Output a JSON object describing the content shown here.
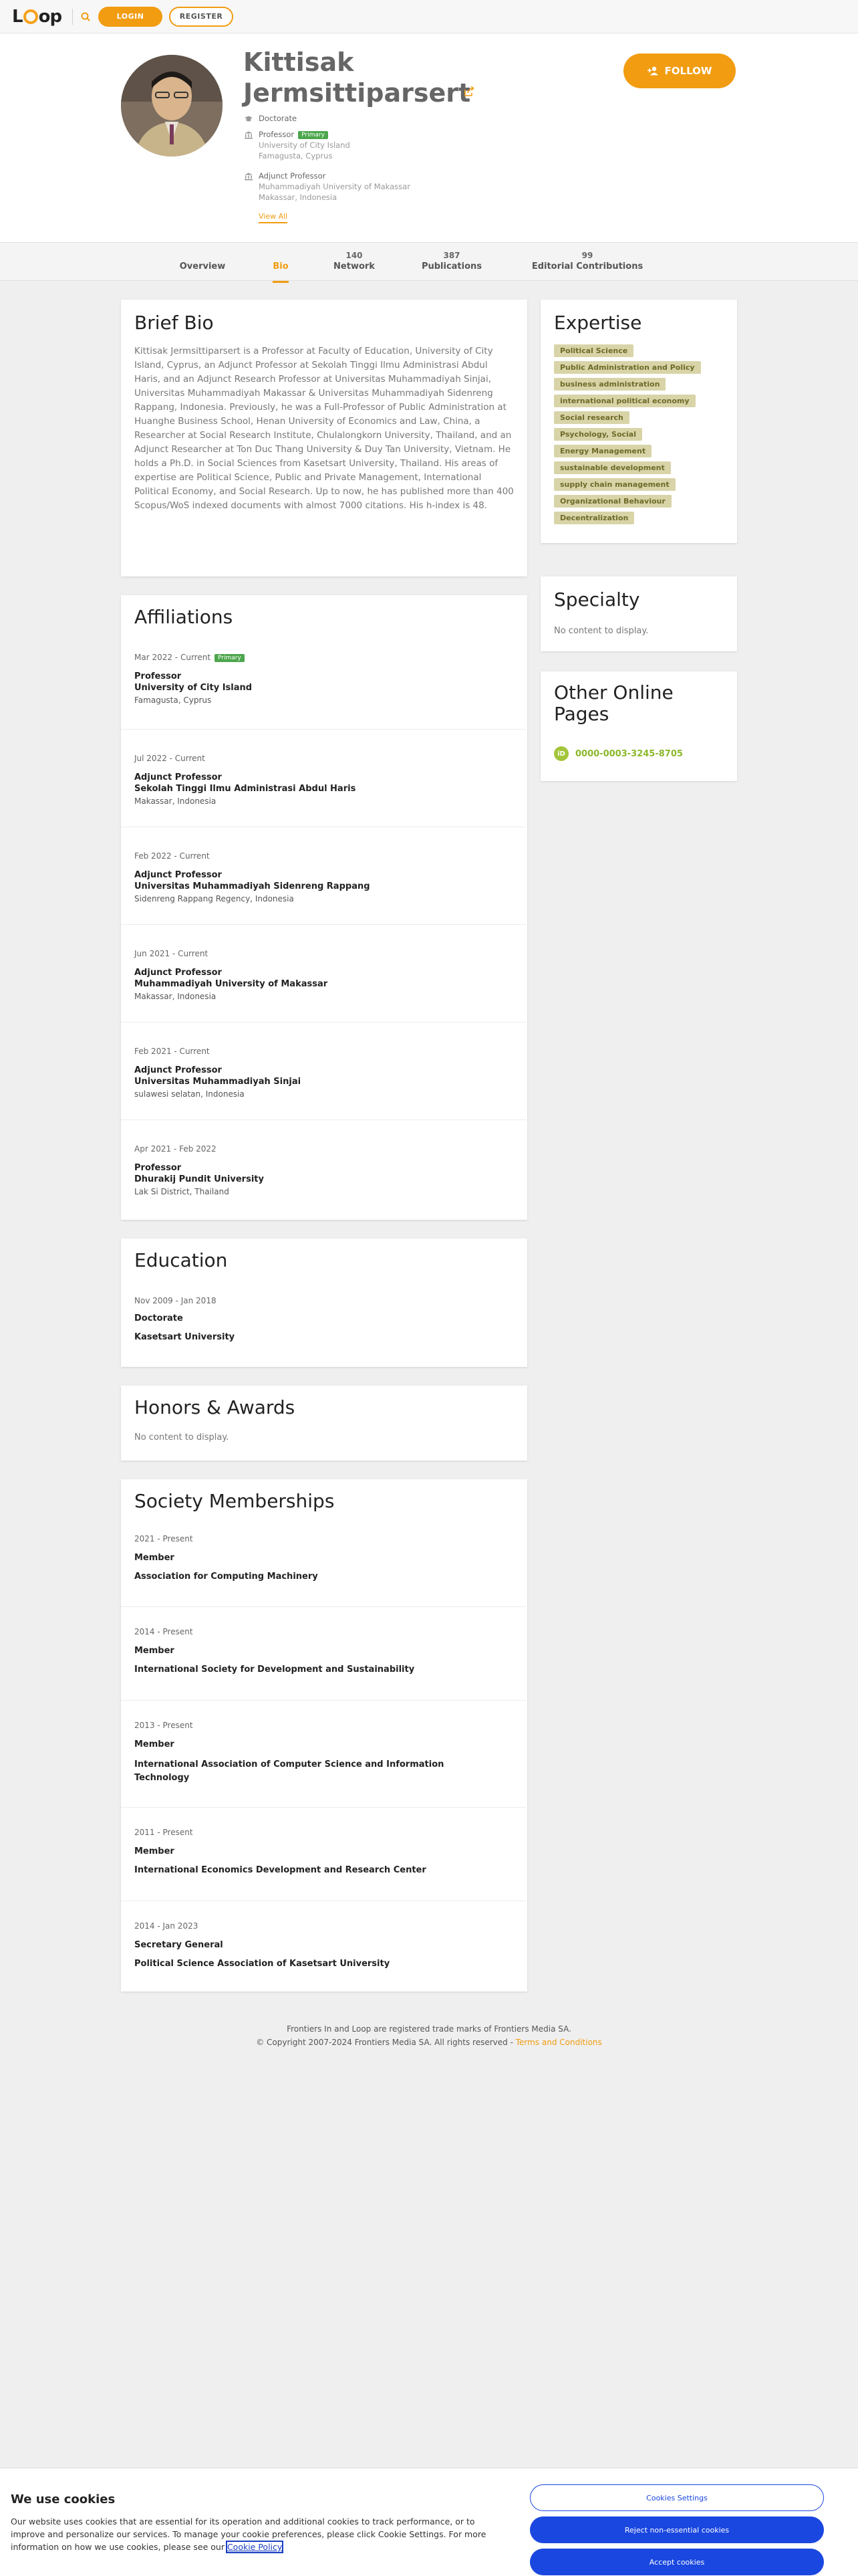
{
  "header": {
    "logo_text_left": "L",
    "logo_text_right": "op",
    "login_label": "LOGIN",
    "register_label": "REGISTER"
  },
  "profile": {
    "first_name": "Kittisak",
    "last_name": "Jermsittiparsert",
    "follow_label": "FOLLOW",
    "degree": "Doctorate",
    "positions": [
      {
        "title": "Professor",
        "badge": "Primary",
        "org": "University of City Island",
        "location": "Famagusta, Cyprus"
      },
      {
        "title": "Adjunct Professor",
        "org": "Muhammadiyah University of Makassar",
        "location": "Makassar, Indonesia"
      }
    ],
    "view_all_label": "View All"
  },
  "tabs": [
    {
      "count": "",
      "label": "Overview"
    },
    {
      "count": "",
      "label": "Bio"
    },
    {
      "count": "140",
      "label": "Network"
    },
    {
      "count": "387",
      "label": "Publications"
    },
    {
      "count": "99",
      "label": "Editorial Contributions"
    }
  ],
  "bio": {
    "title": "Brief Bio",
    "text": "Kittisak Jermsittiparsert is a Professor at Faculty of Education, University of City Island, Cyprus, an Adjunct Professor at Sekolah Tinggi Ilmu Administrasi Abdul Haris, and an Adjunct Research Professor at Universitas Muhammadiyah Sinjai, Universitas Muhammadiyah Makassar & Universitas Muhammadiyah Sidenreng Rappang, Indonesia. Previously, he was a Full-Professor of Public Administration at Huanghe Business School, Henan University of Economics and Law, China, a Researcher at Social Research Institute, Chulalongkorn University, Thailand, and an Adjunct Researcher at Ton Duc Thang University & Duy Tan University, Vietnam. He holds a Ph.D. in Social Sciences from Kasetsart University, Thailand. His areas of expertise are Political Science, Public and Private Management, International Political Economy, and Social Research. Up to now, he has published more than 400 Scopus/WoS indexed documents with almost 7000 citations. His h-index is 48."
  },
  "affiliations": {
    "title": "Affiliations",
    "items": [
      {
        "date": "Mar 2022 - Current",
        "badge": "Primary",
        "role": "Professor",
        "org": "University of City Island",
        "loc": "Famagusta, Cyprus"
      },
      {
        "date": "Jul 2022 - Current",
        "role": "Adjunct Professor",
        "org": "Sekolah Tinggi Ilmu Administrasi Abdul Haris",
        "loc": "Makassar, Indonesia"
      },
      {
        "date": "Feb 2022 - Current",
        "role": "Adjunct Professor",
        "org": "Universitas Muhammadiyah Sidenreng Rappang",
        "loc": "Sidenreng Rappang Regency, Indonesia"
      },
      {
        "date": "Jun 2021 - Current",
        "role": "Adjunct Professor",
        "org": "Muhammadiyah University of Makassar",
        "loc": "Makassar, Indonesia"
      },
      {
        "date": "Feb 2021 - Current",
        "role": "Adjunct Professor",
        "org": "Universitas Muhammadiyah Sinjai",
        "loc": "sulawesi selatan, Indonesia"
      },
      {
        "date": "Apr 2021 - Feb 2022",
        "role": "Professor",
        "org": "Dhurakij Pundit University",
        "loc": "Lak Si District, Thailand"
      }
    ]
  },
  "education": {
    "title": "Education",
    "date": "Nov 2009 - Jan 2018",
    "degree": "Doctorate",
    "school": "Kasetsart University"
  },
  "honors": {
    "title": "Honors & Awards",
    "empty": "No content to display."
  },
  "society": {
    "title": "Society Memberships",
    "items": [
      {
        "date": "2021 - Present",
        "role": "Member",
        "org": "Association for Computing Machinery"
      },
      {
        "date": "2014 - Present",
        "role": "Member",
        "org": "International Society for Development and Sustainability"
      },
      {
        "date": "2013 - Present",
        "role": "Member",
        "org": "International Association of Computer Science and Information Technology"
      },
      {
        "date": "2011 - Present",
        "role": "Member",
        "org": "International Economics Development and Research Center"
      },
      {
        "date": "2014 - Jan 2023",
        "role": "Secretary General",
        "org": "Political Science Association of Kasetsart University"
      }
    ]
  },
  "expertise": {
    "title": "Expertise",
    "tags": [
      "Political Science",
      "Public Administration and Policy",
      "business administration",
      "international political economy",
      "Social research",
      "Psychology, Social",
      "Energy Management",
      "sustainable development",
      "supply chain management",
      "Organizational Behaviour",
      "Decentralization"
    ]
  },
  "specialty": {
    "title": "Specialty",
    "empty": "No content to display."
  },
  "online_pages": {
    "title": "Other Online Pages",
    "orcid_icon_text": "iD",
    "orcid": "0000-0003-3245-8705"
  },
  "footer": {
    "line1": "Frontiers In and Loop are registered trade marks of Frontiers Media SA.",
    "line2": "© Copyright 2007-2024 Frontiers Media SA. All rights reserved - ",
    "terms_label": "Terms and Conditions"
  },
  "cookie": {
    "title": "We use cookies",
    "text": "Our website uses cookies that are essential for its operation and additional cookies to track performance, or to improve and personalize our services. To manage your cookie preferences, please click Cookie Settings. For more information on how we use cookies, please see our ",
    "policy_label": "Cookie Policy",
    "settings_label": "Cookies Settings",
    "reject_label": "Reject non-essential cookies",
    "accept_label": "Accept cookies"
  },
  "colors": {
    "accent": "#f19c11",
    "primary_badge": "#4ca64c",
    "tag_bg": "#d8d4a8",
    "orcid": "#a3c53b",
    "cookie_button": "#1a47e0"
  }
}
